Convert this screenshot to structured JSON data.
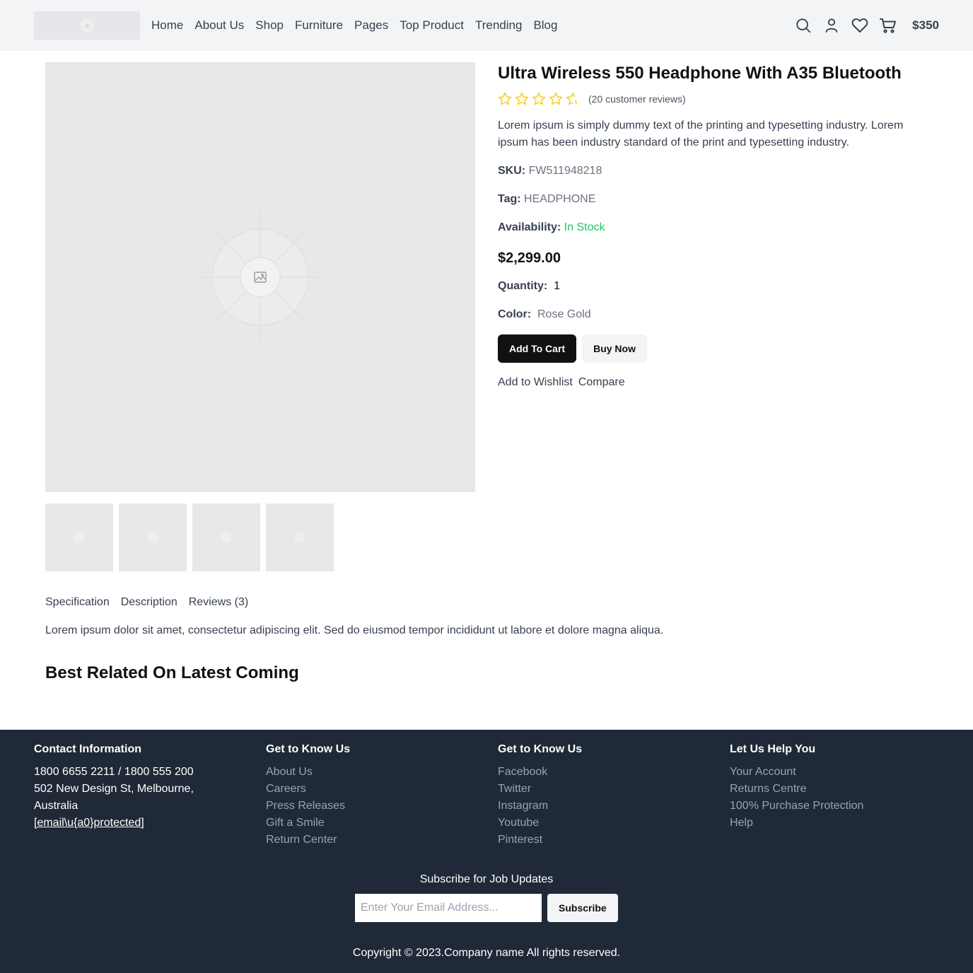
{
  "header": {
    "nav": [
      "Home",
      "About Us",
      "Shop",
      "Furniture",
      "Pages",
      "Top Product",
      "Trending",
      "Blog"
    ],
    "cart_total": "$350",
    "icons": [
      "search-icon",
      "user-icon",
      "heart-icon",
      "cart-icon"
    ]
  },
  "product": {
    "title": "Ultra Wireless 550 Headphone With A35 Bluetooth",
    "rating": 4.5,
    "rating_max": 5,
    "reviews_text": "(20 customer reviews)",
    "description": "Lorem ipsum is simply dummy text of the printing and typesetting industry. Lorem ipsum has been industry standard of the print and typesetting industry.",
    "sku_label": "SKU:",
    "sku": "FW511948218",
    "tag_label": "Tag:",
    "tag": "HEADPHONE",
    "availability_label": "Availability:",
    "availability": "In Stock",
    "price": "$2,299.00",
    "quantity_label": "Quantity:",
    "quantity": "1",
    "color_label": "Color:",
    "color": "Rose Gold",
    "add_to_cart": "Add To Cart",
    "buy_now": "Buy Now",
    "add_to_wishlist": "Add to Wishlist",
    "compare": "Compare",
    "thumbnail_count": 4
  },
  "tabs": {
    "items": [
      "Specification",
      "Description",
      "Reviews (3)"
    ],
    "content": "Lorem ipsum dolor sit amet, consectetur adipiscing elit. Sed do eiusmod tempor incididunt ut labore et dolore magna aliqua."
  },
  "related": {
    "heading": "Best Related On Latest Coming"
  },
  "footer": {
    "contact": {
      "heading": "Contact Information",
      "phone": "1800 6655 2211 / 1800 555 200",
      "address_line1": "502 New Design St, Melbourne,",
      "address_line2": "Australia",
      "email": "[email\\u{a0}protected]"
    },
    "col2": {
      "heading": "Get to Know Us",
      "links": [
        "About Us",
        "Careers",
        "Press Releases",
        "Gift a Smile",
        "Return Center"
      ]
    },
    "col3": {
      "heading": "Get to Know Us",
      "links": [
        "Facebook",
        "Twitter",
        "Instagram",
        "Youtube",
        "Pinterest"
      ]
    },
    "col4": {
      "heading": "Let Us Help You",
      "links": [
        "Your Account",
        "Returns Centre",
        "100% Purchase Protection",
        "Help"
      ]
    },
    "subscribe_title": "Subscribe for Job Updates",
    "subscribe_placeholder": "Enter Your Email Address...",
    "subscribe_button": "Subscribe",
    "copyright": "Copyright © 2023.Company name All rights reserved."
  },
  "colors": {
    "header_bg": "#f3f4f6",
    "footer_bg": "#1f2937",
    "in_stock": "#22c55e",
    "star": "#facc15",
    "primary_button": "#111111"
  }
}
